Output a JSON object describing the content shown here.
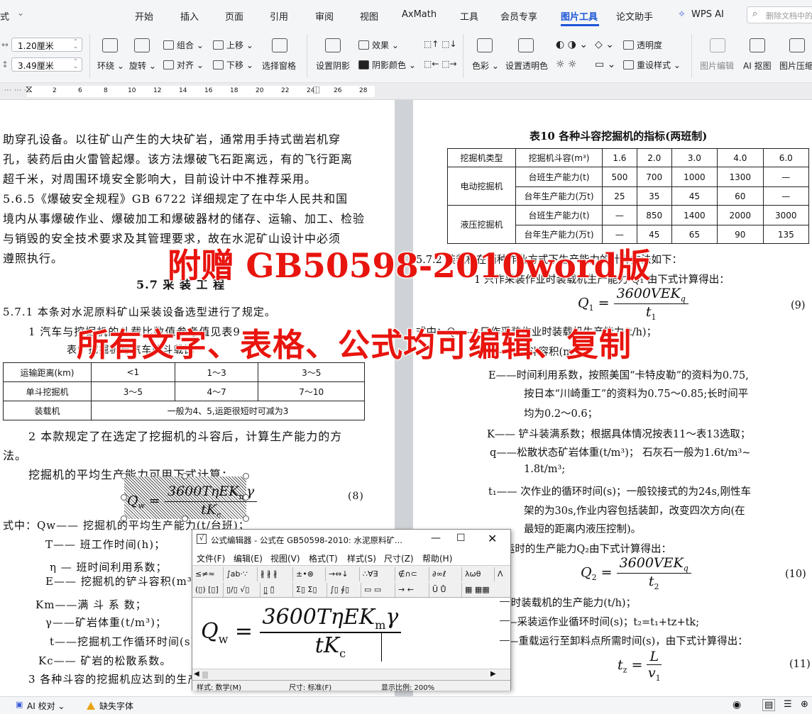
{
  "menu": {
    "left_cut": "式",
    "items": [
      "开始",
      "插入",
      "页面",
      "引用",
      "审阅",
      "视图",
      "AxMath",
      "工具",
      "会员专享",
      "图片工具",
      "论文助手",
      "WPS AI"
    ],
    "active": "图片工具",
    "search_placeholder": "删除文档中的"
  },
  "toolbar": {
    "width_value": "1.20厘米",
    "height_value": "3.49厘米",
    "wrap": "环绕",
    "rotate": "旋转",
    "group": "组合",
    "align": "对齐",
    "move_up": "上移",
    "move_down": "下移",
    "selection_pane": "选择窗格",
    "set_shadow": "设置阴影",
    "effect": "效果",
    "shadow_color": "阴影颜色",
    "color": "色彩",
    "set_transparent": "设置透明色",
    "transparency": "透明度",
    "reset_style": "重设样式",
    "image_edit": "图片编辑",
    "ai_cutout": "AI 抠图",
    "image_compress": "图片压缩"
  },
  "ruler": {
    "left_marks": [
      "2",
      "4",
      "6",
      "8",
      "10",
      "12",
      "14",
      "16",
      "18",
      "20",
      "22",
      "24",
      "26",
      "28"
    ],
    "right_marks": [
      "2",
      "4",
      "6",
      "8",
      "10",
      "12",
      "14",
      "16",
      "18",
      "20",
      "22"
    ]
  },
  "left_page": {
    "para1": [
      "助穿孔设备。以往矿山产生的大块矿岩，通常用手持式凿岩机穿",
      "孔，装药后由火雷管起爆。该方法爆破飞石距离远，有的飞行距离",
      "超千米，对周围环境安全影响大，目前设计中不推荐采用。"
    ],
    "para2": [
      "5.6.5《爆破安全规程》GB  6722 详细规定了在中华人民共和国",
      "境内从事爆破作业、爆破加工和爆破器材的储存、运输、加工、检验",
      "与销毁的安全技术要求及其管理要求，故在水泥矿山设计中必须",
      "遵照执行。"
    ],
    "section_head": "5.7  采 装 工 程",
    "para3": "5.7.1   本条对水泥原料矿山采装设备选型进行了规定。",
    "para4": "1   汽车与挖掘机的斗载比数值参考值见表9",
    "table9_title": "表9   挖掘机与汽车的斗载比",
    "table9": {
      "rows": [
        [
          "运输距离(km)",
          "<1",
          "1～3",
          "3～5"
        ],
        [
          "单斗挖掘机",
          "3～5",
          "4～7",
          "7～10"
        ],
        [
          "装载机",
          "一般为4、5,运距很短时可减为3"
        ]
      ]
    },
    "para5a": "2   本款规定了在选定了挖掘机的斗容后，计算生产能力的方",
    "para5b": "法。",
    "para6": "挖掘机的平均生产能力可用下式计算：",
    "eq8_lhs": "Q",
    "eq8_lhs_sub": "w",
    "eq8_num": "3600TηEK",
    "eq8_num_sub": "m",
    "eq8_num_tail": "γ",
    "eq8_den": "tK",
    "eq8_den_sub": "c",
    "eq8_no": "(8)",
    "defs": [
      "式中：Qw—— 挖掘机的平均生产能力(t/台班)；",
      "T—— 班工作时间(h)；",
      "η  — 班时间利用系数；",
      "E—— 挖掘机的铲斗容积(m³)；",
      "Km——满 斗 系 数；",
      "γ——矿岩体重(t/m³)；",
      "t——挖掘机工作循环时间(s)；",
      "Kc—— 矿岩的松散系数。"
    ],
    "para7": "3   各种斗容的挖掘机应达到的生产能力，见表10。"
  },
  "right_page": {
    "table10_title": "表10  各种斗容挖掘机的指标(两班制)",
    "table10": {
      "header": [
        "挖掘机类型",
        "挖掘机斗容(m³)",
        "1.6",
        "2.0",
        "3.0",
        "4.0",
        "6.0"
      ],
      "group1": "电动挖掘机",
      "group1_rows": [
        [
          "台班生产能力(t)",
          "500",
          "700",
          "1000",
          "1300",
          "—"
        ],
        [
          "台年生产能力(万t)",
          "25",
          "35",
          "45",
          "60",
          "—"
        ]
      ],
      "group2": "液压挖掘机",
      "group2_rows": [
        [
          "台班生产能力(t)",
          "—",
          "850",
          "1400",
          "2000",
          "3000"
        ],
        [
          "台年生产能力(万t)",
          "—",
          "45",
          "65",
          "90",
          "135"
        ]
      ]
    },
    "line1": "5.7.2 装载机在两种作业方式下生产能力的计算方法如下：",
    "line2": "1   只作采装作业时装载机生产能力 Q₁ 由下式计算得出：",
    "eq9_lhs": "Q",
    "eq9_lhs_sub": "1",
    "eq9_num": "3600VEK",
    "eq9_num_sub": "q",
    "eq9_den": "t",
    "eq9_den_sub": "1",
    "eq9_no": "(9)",
    "line3": "式中：Q₁——只作采装作业时装载机生产能力(t/h)；",
    "line4": "V——铲斗容积(m³)；",
    "line5": "E——时间利用系数，按照美国“卡特皮勒”的资料为0.75,",
    "line6": "按日本“川崎重工”的资料为0.75～0.85;长时间平",
    "line7": "均为0.2～0.6；",
    "line8": "K—— 铲斗装满系数；根据具体情况按表11～表13选取；",
    "line9": "q——松散状态矿岩体重(t/m³)； 石灰石一般为1.6t/m³~",
    "line10": "1.8t/m³;",
    "line11": "t₁—— 次作业的循环时间(s)；一般铰接式的为24s,刚性车",
    "line12": "架的为30s,作业内容包括装卸，改变四次方向(在",
    "line13": "最短的距离内液压控制)。",
    "line14": "2   采装运时的生产能力Q₂由下式计算得出：",
    "eq10_lhs": "Q",
    "eq10_lhs_sub": "2",
    "eq10_num": "3600VEK",
    "eq10_num_sub": "q",
    "eq10_den": "t",
    "eq10_den_sub": "2",
    "eq10_no": "(10)",
    "line15": "式中：Q₂——采装运时装载机的生产能力(t/h)；",
    "line16": "t₂——采装运作业循环时间(s)；t₂=t₁+tz+tk;",
    "line17": "tz——重载运行至卸料点所需时间(s)，由下式计算得出：",
    "eq11_lhs": "t",
    "eq11_lhs_sub": "z",
    "eq11_num": "L",
    "eq11_den": "v",
    "eq11_den_sub": "1",
    "eq11_no": "(11)"
  },
  "overlay": {
    "line1": "附赠 GB50598-2010word版",
    "line2": "所有文字、表格、公式均可编辑、复制",
    "color": "#e8140e"
  },
  "equation_editor": {
    "title": "公式编辑器 - 公式在 GB50598-2010: 水泥原料矿...",
    "menu": [
      "文件(F)",
      "编辑(E)",
      "视图(V)",
      "格式(T)",
      "样式(S)",
      "尺寸(Z)",
      "帮助(H)"
    ],
    "palette_row1": [
      "≤≠≈",
      "∫ab·∵",
      "∦ ∦ ∦",
      "±•⊗",
      "→⇔↓",
      "∴∀∃",
      "∉∩⊂",
      "∂∞ℓ",
      "λωθ",
      "Λ"
    ],
    "palette_row2": [
      "(▯) [▯]",
      "▯/▯ √▯",
      "▯̲ ▯̈",
      "Σ▯ Σ▯",
      "∫▯ ∮▯",
      "▭ ▭",
      "→ ←",
      "Ū Ů",
      "▦ ▦▦"
    ],
    "status_style": "样式: 数学(M)",
    "status_size": "尺寸: 标准(F)",
    "status_zoom": "显示比例: 200%"
  },
  "statusbar": {
    "ai_check": "AI 校对",
    "missing_font": "缺失字体"
  }
}
